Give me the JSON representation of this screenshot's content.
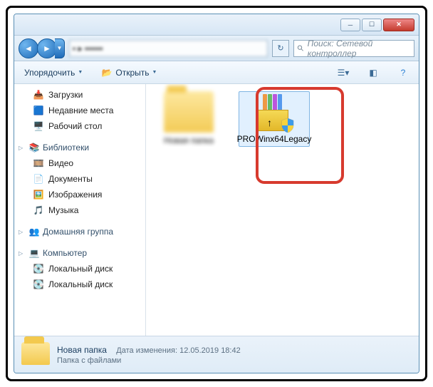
{
  "search": {
    "placeholder": "Поиск: Сетевой контроллер"
  },
  "toolbar": {
    "organize": "Упорядочить",
    "open": "Открыть"
  },
  "sidebar": {
    "items": [
      {
        "label": "Загрузки"
      },
      {
        "label": "Недавние места"
      },
      {
        "label": "Рабочий стол"
      }
    ],
    "libraries": {
      "header": "Библиотеки",
      "items": [
        {
          "label": "Видео"
        },
        {
          "label": "Документы"
        },
        {
          "label": "Изображения"
        },
        {
          "label": "Музыка"
        }
      ]
    },
    "homegroup": {
      "header": "Домашняя группа"
    },
    "computer": {
      "header": "Компьютер",
      "items": [
        {
          "label": "Локальный диск"
        },
        {
          "label": "Локальный диск"
        }
      ]
    }
  },
  "files": {
    "folder": {
      "name": "Новая папка"
    },
    "installer": {
      "name": "PROWinx64Legacy"
    }
  },
  "status": {
    "name": "Новая папка",
    "type": "Папка с файлами",
    "modified_label": "Дата изменения:",
    "modified_value": "12.05.2019 18:42"
  }
}
